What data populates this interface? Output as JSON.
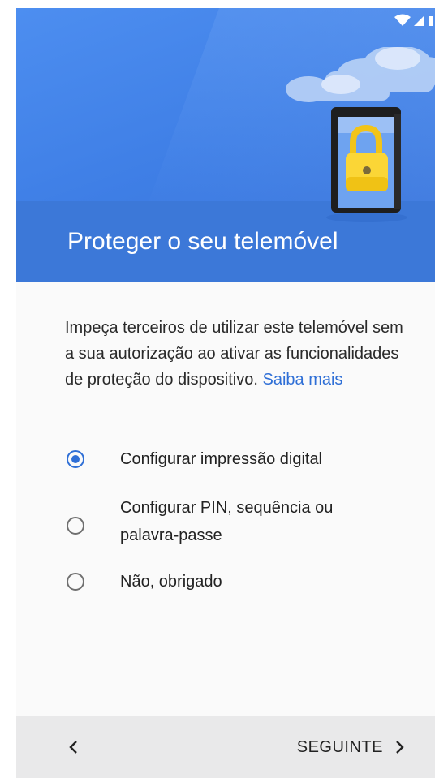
{
  "header": {
    "title": "Proteger o seu telemóvel"
  },
  "body": {
    "description": "Impeça terceiros de utilizar este telemóvel sem a sua autorização ao ativar as funcionalidades de proteção do dispositivo.",
    "learn_more_link": "Saiba mais"
  },
  "options": [
    {
      "label": "Configurar impressão digital",
      "selected": true
    },
    {
      "label": "Configurar PIN, sequência ou palavra-passe",
      "selected": false
    },
    {
      "label": "Não, obrigado",
      "selected": false
    }
  ],
  "navigation": {
    "back_icon": "chevron-left-icon",
    "next_label": "SEGUINTE",
    "next_icon": "chevron-right-icon"
  },
  "status_bar": {
    "icons": [
      "wifi-icon",
      "signal-icon"
    ]
  },
  "colors": {
    "header_blue": "#4d8ef0",
    "title_band": "#3c78d8",
    "accent": "#2f6fd6",
    "bottom_bar": "#e9e9ea"
  }
}
